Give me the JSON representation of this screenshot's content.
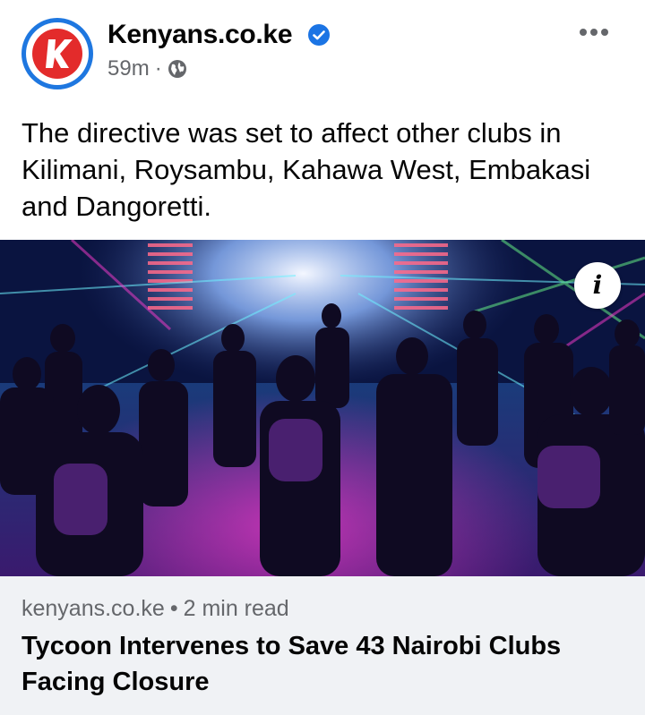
{
  "post": {
    "page_name": "Kenyans.co.ke",
    "timestamp": "59m",
    "separator": "·",
    "audience_icon": "globe-icon",
    "verified_icon": "verified-badge-icon",
    "more_icon": "more-options-icon",
    "text": "The directive was set to affect other clubs in Kilimani, Roysambu, Kahawa West, Embakasi and Dangoretti."
  },
  "media": {
    "info_icon": "info-icon",
    "info_label": "i"
  },
  "link": {
    "domain": "kenyans.co.ke",
    "separator": "•",
    "read_time": "2 min read",
    "title": "Tycoon Intervenes to Save 43 Nairobi Clubs Facing Closure"
  },
  "colors": {
    "brand_red": "#e32b2b",
    "verified_blue": "#1b74e4",
    "secondary_text": "#65676b",
    "card_bg": "#f0f2f5"
  }
}
